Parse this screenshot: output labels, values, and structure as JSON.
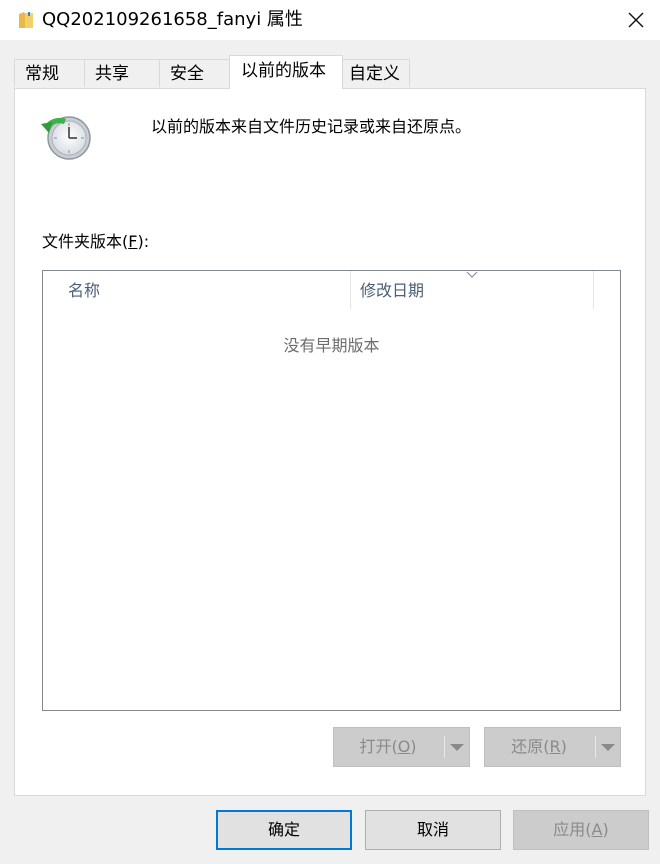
{
  "window": {
    "title": "QQ202109261658_fanyi 属性",
    "icon": "folder-icon",
    "close_icon": "close-icon"
  },
  "tabs": [
    {
      "label": "常规"
    },
    {
      "label": "共享"
    },
    {
      "label": "安全"
    },
    {
      "label": "以前的版本",
      "active": true
    },
    {
      "label": "自定义"
    }
  ],
  "panel": {
    "description": "以前的版本来自文件历史记录或来自还原点。",
    "icon": "history-clock-icon",
    "versions_label_prefix": "文件夹版本(",
    "versions_label_key": "F",
    "versions_label_suffix": "):",
    "list": {
      "columns": [
        {
          "label": "名称"
        },
        {
          "label": "修改日期",
          "sorted": "descending"
        }
      ],
      "empty_text": "没有早期版本"
    },
    "open_button": {
      "prefix": "打开(",
      "key": "O",
      "suffix": ")",
      "enabled": false
    },
    "restore_button": {
      "prefix": "还原(",
      "key": "R",
      "suffix": ")",
      "enabled": false
    }
  },
  "footer": {
    "ok": "确定",
    "cancel": "取消",
    "apply_prefix": "应用(",
    "apply_key": "A",
    "apply_suffix": ")"
  },
  "colors": {
    "accent": "#0078d7",
    "dialog_bg": "#f0f0f0",
    "header_text": "#4c607a",
    "disabled_text": "#8a8a8a"
  }
}
